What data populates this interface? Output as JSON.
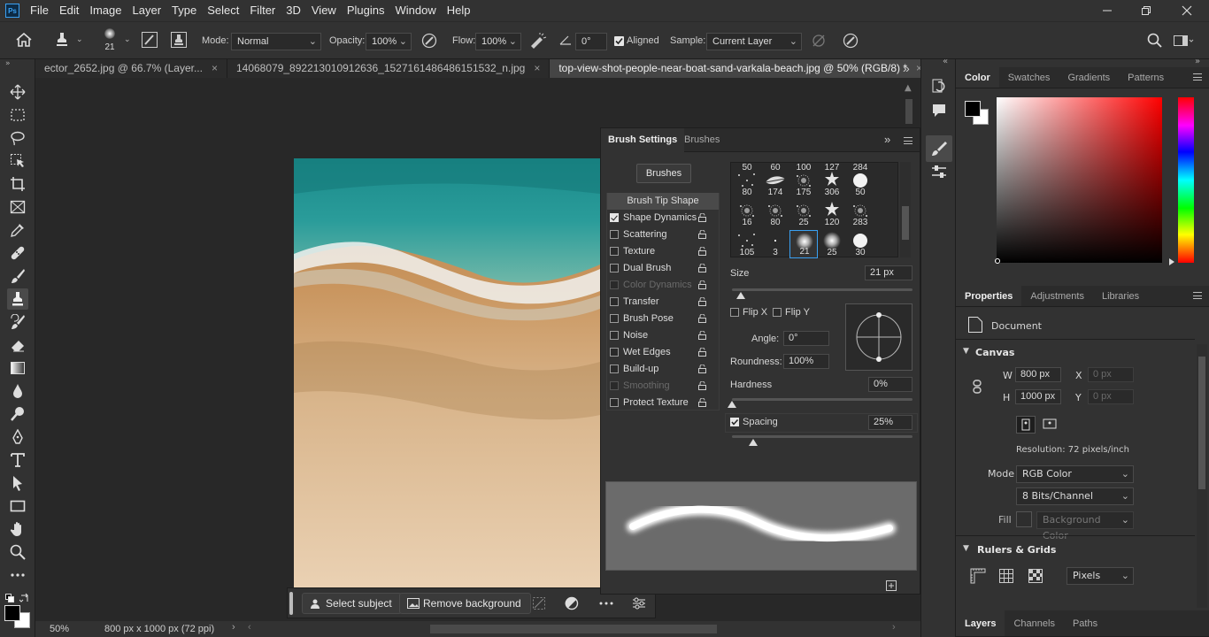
{
  "menu": {
    "logo": "Ps",
    "items": [
      "File",
      "Edit",
      "Image",
      "Layer",
      "Type",
      "Select",
      "Filter",
      "3D",
      "View",
      "Plugins",
      "Window",
      "Help"
    ]
  },
  "options": {
    "brush_size": "21",
    "mode_label": "Mode:",
    "mode_value": "Normal",
    "opacity_label": "Opacity:",
    "opacity_value": "100%",
    "flow_label": "Flow:",
    "flow_value": "100%",
    "angle_value": "0°",
    "aligned_label": "Aligned",
    "aligned_checked": true,
    "sample_label": "Sample:",
    "sample_value": "Current Layer"
  },
  "tabs": [
    {
      "label": "ector_2652.jpg @ 66.7% (Layer...",
      "close": "×"
    },
    {
      "label": "14068079_892213010912636_1527161486486151532_n.jpg",
      "close": "×"
    },
    {
      "label": "top-view-shot-people-near-boat-sand-varkala-beach.jpg @ 50% (RGB/8) *",
      "close": "×"
    }
  ],
  "status": {
    "zoom": "50%",
    "doc_size": "800 px x 1000 px (72 ppi)"
  },
  "context_bar": {
    "select_subject": "Select subject",
    "remove_background": "Remove background"
  },
  "brush_panel": {
    "tabs": [
      "Brush Settings",
      "Brushes"
    ],
    "brushes_button": "Brushes",
    "options": [
      {
        "label": "Brush Tip Shape",
        "checkbox": null,
        "lock": false,
        "selected": true
      },
      {
        "label": "Shape Dynamics",
        "checkbox": true,
        "lock": true
      },
      {
        "label": "Scattering",
        "checkbox": false,
        "lock": true
      },
      {
        "label": "Texture",
        "checkbox": false,
        "lock": true
      },
      {
        "label": "Dual Brush",
        "checkbox": false,
        "lock": true
      },
      {
        "label": "Color Dynamics",
        "checkbox": false,
        "lock": true,
        "disabled": true
      },
      {
        "label": "Transfer",
        "checkbox": false,
        "lock": true
      },
      {
        "label": "Brush Pose",
        "checkbox": false,
        "lock": true
      },
      {
        "label": "Noise",
        "checkbox": false,
        "lock": true
      },
      {
        "label": "Wet Edges",
        "checkbox": false,
        "lock": true
      },
      {
        "label": "Build-up",
        "checkbox": false,
        "lock": true
      },
      {
        "label": "Smoothing",
        "checkbox": false,
        "lock": true,
        "disabled": true
      },
      {
        "label": "Protect Texture",
        "checkbox": false,
        "lock": true
      }
    ],
    "tip_header": [
      "50",
      "60",
      "100",
      "127",
      "284"
    ],
    "tips": [
      [
        {
          "n": "80",
          "k": "scatter"
        },
        {
          "n": "174",
          "k": "leaf"
        },
        {
          "n": "175",
          "k": "spray"
        },
        {
          "n": "306",
          "k": "star"
        },
        {
          "n": "50",
          "k": "hard"
        }
      ],
      [
        {
          "n": "16",
          "k": "spray"
        },
        {
          "n": "80",
          "k": "spray"
        },
        {
          "n": "25",
          "k": "spray"
        },
        {
          "n": "120",
          "k": "star"
        },
        {
          "n": "283",
          "k": "spray"
        }
      ],
      [
        {
          "n": "105",
          "k": "scatter"
        },
        {
          "n": "3",
          "k": "dot"
        },
        {
          "n": "21",
          "k": "soft",
          "selected": true
        },
        {
          "n": "25",
          "k": "soft"
        },
        {
          "n": "30",
          "k": "hard"
        }
      ]
    ],
    "size_label": "Size",
    "size_value": "21 px",
    "size_level": 0.05,
    "flip_x": "Flip X",
    "flip_y": "Flip Y",
    "angle_label": "Angle:",
    "angle_value": "0°",
    "roundness_label": "Roundness:",
    "roundness_value": "100%",
    "hardness_label": "Hardness",
    "hardness_value": "0%",
    "hardness_level": 0,
    "spacing_label": "Spacing",
    "spacing_checked": true,
    "spacing_value": "25%",
    "spacing_level": 0.12
  },
  "color_panel": {
    "tabs": [
      "Color",
      "Swatches",
      "Gradients",
      "Patterns"
    ],
    "hue_color": "#ff0000"
  },
  "properties": {
    "tabs": [
      "Properties",
      "Adjustments",
      "Libraries"
    ],
    "doc_label": "Document",
    "canvas_section": "Canvas",
    "w_label": "W",
    "w_value": "800 px",
    "h_label": "H",
    "h_value": "1000 px",
    "x_label": "X",
    "x_value": "0 px",
    "y_label": "Y",
    "y_value": "0 px",
    "resolution": "Resolution: 72 pixels/inch",
    "mode_label": "Mode",
    "mode_value": "RGB Color",
    "bits_value": "8 Bits/Channel",
    "fill_label": "Fill",
    "fill_value": "Background Color",
    "rulers_section": "Rulers & Grids",
    "units_value": "Pixels"
  },
  "layers_tabs": [
    "Layers",
    "Channels",
    "Paths"
  ]
}
